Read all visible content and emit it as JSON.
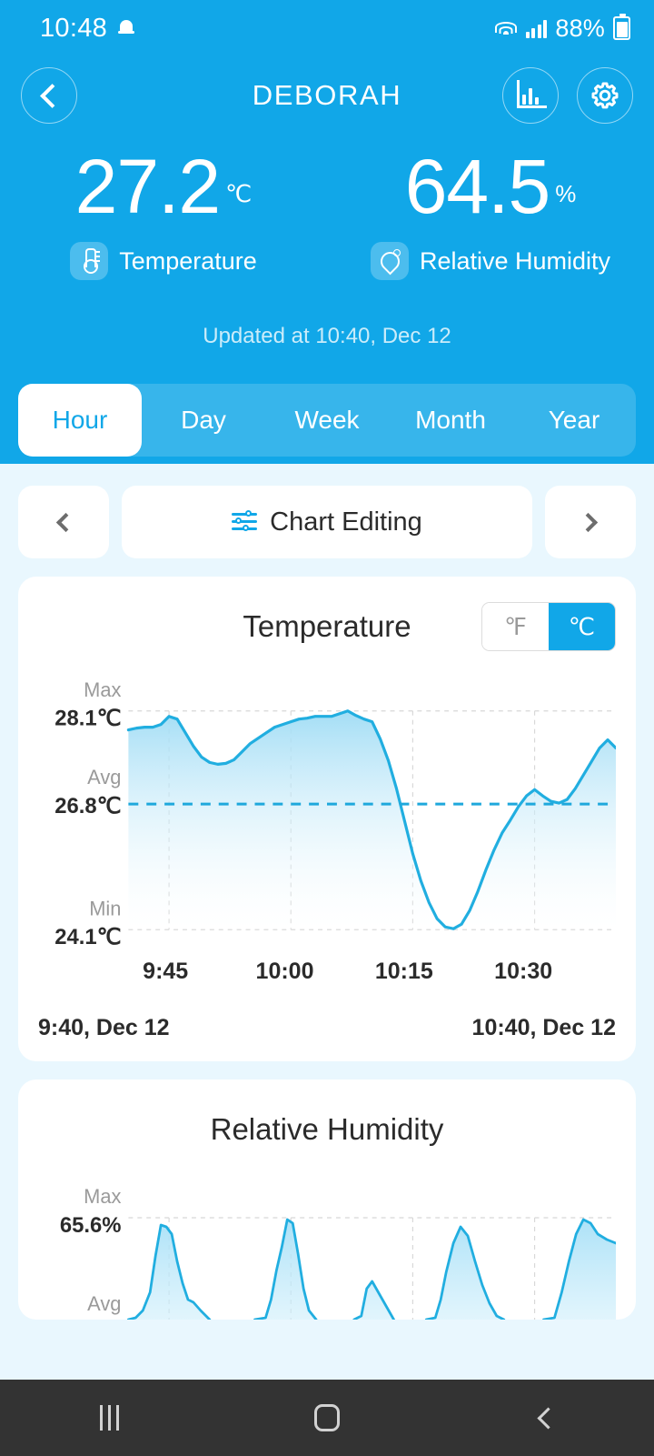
{
  "status_bar": {
    "time": "10:48",
    "battery": "88%",
    "icons": [
      "bell-icon",
      "wifi-icon",
      "signal-icon",
      "battery-icon"
    ]
  },
  "header": {
    "title": "DEBORAH",
    "back_icon": "chevron-left-icon",
    "chart_icon": "bar-chart-icon",
    "settings_icon": "gear-icon",
    "updated_text": "Updated at 10:40, Dec 12",
    "accent_color": "#11a7e8"
  },
  "readings": [
    {
      "value": "27.2",
      "unit": "℃",
      "label": "Temperature",
      "icon": "thermometer-icon"
    },
    {
      "value": "64.5",
      "unit": "%",
      "label": "Relative Humidity",
      "icon": "humidity-droplet-icon"
    }
  ],
  "range_tabs": {
    "items": [
      "Hour",
      "Day",
      "Week",
      "Month",
      "Year"
    ],
    "active": "Hour"
  },
  "toolbar": {
    "prev_icon": "chevron-left-icon",
    "next_icon": "chevron-right-icon",
    "chart_editing_label": "Chart Editing",
    "chart_editing_icon": "tune-sliders-icon"
  },
  "temperature_card": {
    "title": "Temperature",
    "unit_options": [
      "℉",
      "℃"
    ],
    "unit_selected": "℃",
    "stats": {
      "max_label": "Max",
      "max_value": "28.1℃",
      "avg_label": "Avg",
      "avg_value": "26.8℃",
      "min_label": "Min",
      "min_value": "24.1℃"
    },
    "start_time": "9:40, Dec 12",
    "end_time": "10:40, Dec 12"
  },
  "humidity_card": {
    "title": "Relative Humidity",
    "stats": {
      "max_label": "Max",
      "max_value": "65.6%",
      "avg_label": "Avg"
    }
  },
  "navbar": {
    "recents_icon": "recents-icon",
    "home_icon": "home-icon",
    "back_icon": "back-icon"
  },
  "chart_data": [
    {
      "type": "area",
      "title": "Temperature",
      "xlabel": "",
      "ylabel": "℃",
      "ylim": [
        24.1,
        28.1
      ],
      "xlim": [
        "9:40",
        "10:40"
      ],
      "grid": true,
      "legend": "none",
      "tick_labels_x": [
        "9:45",
        "10:00",
        "10:15",
        "10:30"
      ],
      "tick_positions_x": [
        0.083,
        0.333,
        0.583,
        0.833
      ],
      "annotations": {
        "max": 28.1,
        "avg": 26.8,
        "min": 24.1,
        "avg_line": true
      },
      "x": [
        0,
        1,
        2,
        3,
        4,
        5,
        6,
        7,
        8,
        9,
        10,
        11,
        12,
        13,
        14,
        15,
        16,
        17,
        18,
        19,
        20,
        21,
        22,
        23,
        24,
        25,
        26,
        27,
        28,
        29,
        30,
        31,
        32,
        33,
        34,
        35,
        36,
        37,
        38,
        39,
        40,
        41,
        42,
        43,
        44,
        45,
        46,
        47,
        48,
        49,
        50,
        51,
        52,
        53,
        54,
        55,
        56,
        57,
        58,
        59,
        60
      ],
      "values": [
        27.75,
        27.78,
        27.8,
        27.79,
        27.85,
        28.0,
        27.95,
        27.7,
        27.45,
        27.25,
        27.15,
        27.12,
        27.13,
        27.2,
        27.35,
        27.5,
        27.6,
        27.7,
        27.8,
        27.85,
        27.9,
        27.95,
        27.98,
        28.0,
        28.0,
        28.0,
        28.05,
        28.1,
        28.02,
        27.95,
        27.9,
        27.6,
        27.2,
        26.7,
        26.1,
        25.5,
        25.0,
        24.6,
        24.3,
        24.15,
        24.12,
        24.2,
        24.45,
        24.8,
        25.2,
        25.6,
        25.95,
        26.25,
        26.5,
        26.7,
        26.82,
        26.7,
        26.6,
        26.58,
        26.65,
        26.85,
        27.1,
        27.35,
        27.6,
        27.75,
        27.6
      ]
    },
    {
      "type": "area",
      "title": "Relative Humidity",
      "ylabel": "%",
      "ylim": [
        null,
        65.6
      ],
      "grid": true,
      "legend": "none",
      "annotations": {
        "max": 65.6
      },
      "note": "chart is cut off at bottom of viewport; five spikes visible",
      "x": [
        0,
        1,
        2,
        3,
        4,
        5,
        6,
        7,
        8,
        9,
        10,
        11,
        12,
        13,
        14,
        15,
        16,
        17,
        18,
        19,
        20,
        21,
        22,
        23,
        24,
        25,
        26,
        27,
        28,
        29,
        30,
        31,
        32,
        33,
        34,
        35,
        36,
        37,
        38,
        39,
        40,
        41,
        42,
        43,
        44,
        45,
        46,
        47,
        48,
        49,
        50,
        51,
        52,
        53,
        54,
        55,
        56,
        57,
        58,
        59,
        60
      ],
      "values": [
        58,
        58,
        58.5,
        60,
        63,
        65.4,
        65.2,
        64.8,
        63,
        61,
        59.5,
        59.2,
        58.6,
        58,
        58,
        58,
        58,
        58,
        58,
        58,
        58.5,
        60,
        62,
        65.6,
        64,
        61,
        58.8,
        58,
        58,
        58,
        58,
        58.4,
        59.5,
        59,
        58.3,
        58,
        58,
        58,
        58,
        58,
        58.5,
        60.5,
        63,
        65.0,
        64.5,
        62,
        60,
        58.8,
        58.4,
        58,
        58,
        58,
        58,
        58.6,
        60,
        62.5,
        65.5,
        65.0,
        64.5,
        64,
        63.5
      ]
    }
  ]
}
